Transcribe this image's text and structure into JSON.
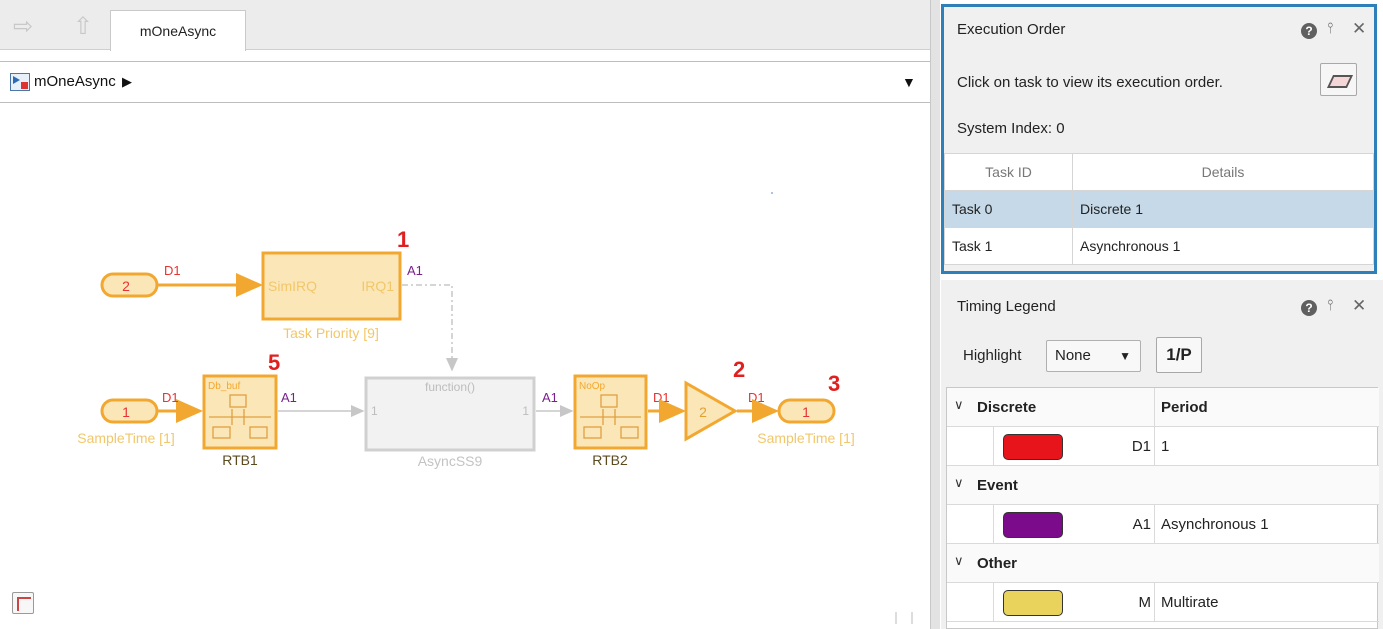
{
  "editor": {
    "tab_label": "mOneAsync",
    "address_label": "mOneAsync"
  },
  "diagram": {
    "exec_numbers": [
      "1",
      "5",
      "2",
      "3"
    ],
    "port_in_d1": "2",
    "port_in_sample": "1",
    "port_out": "1",
    "sim_irq_left": "SimIRQ",
    "sim_irq_right": "IRQ1",
    "task_priority_caption": "Task Priority [9]",
    "rtb1_inner": "Db_buf",
    "rtb1_caption": "RTB1",
    "async_ss_inner": "function()",
    "async_ss_in": "1",
    "async_ss_out": "1",
    "async_ss_caption": "AsyncSS9",
    "rtb2_inner": "NoOp",
    "rtb2_caption": "RTB2",
    "gain_value": "2",
    "sample_time_caption": "SampleTime [1]",
    "signal_labels": {
      "d1_top": "D1",
      "a1_top": "A1",
      "d1_in": "D1",
      "a1_rtb1": "A1",
      "a1_async": "A1",
      "d1_rtb2": "D1",
      "d1_gain": "D1"
    },
    "colors": {
      "discrete_line": "#f2a830",
      "discrete_text": "#e63333",
      "async_text": "#7a1f8c",
      "block_fill": "#fbe6b8",
      "block_stroke": "#f2a830",
      "async_block": "#bdbdbd"
    }
  },
  "exec_panel": {
    "title": "Execution Order",
    "help_icon": "question-icon",
    "instruction": "Click on task to view its execution order.",
    "system_index": "System Index: 0",
    "columns": [
      "Task ID",
      "Details"
    ],
    "rows": [
      {
        "task": "Task 0",
        "details": "Discrete 1",
        "selected": true
      },
      {
        "task": "Task 1",
        "details": "Asynchronous 1",
        "selected": false
      }
    ]
  },
  "legend_panel": {
    "title": "Timing Legend",
    "highlight_label": "Highlight",
    "highlight_value": "None",
    "period_button": "1/P",
    "header_category": "Discrete",
    "header_column": "Period",
    "categories": [
      {
        "label": "Discrete",
        "item": {
          "color": "#e8141c",
          "code": "D1",
          "period": "1"
        }
      },
      {
        "label": "Event",
        "item": {
          "color": "#7b0b8a",
          "code": "A1",
          "period": "Asynchronous 1"
        }
      },
      {
        "label": "Other",
        "item": {
          "color": "#e9d35c",
          "code": "M",
          "period": "Multirate"
        }
      }
    ]
  }
}
